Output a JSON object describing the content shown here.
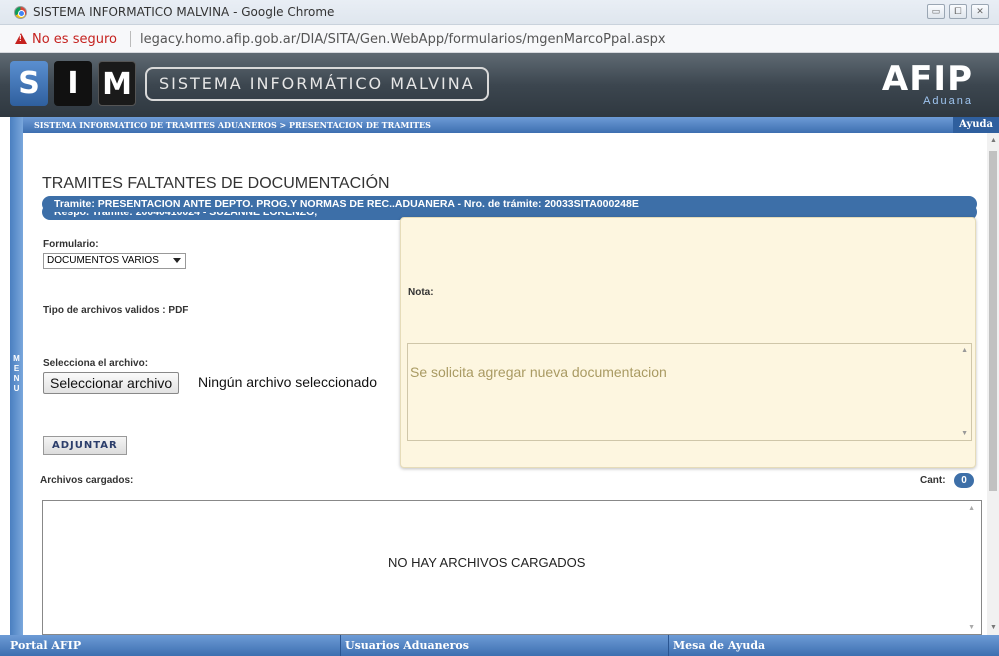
{
  "window": {
    "title": "SISTEMA INFORMATICO MALVINA - Google Chrome",
    "controls": [
      "▭",
      "⧠",
      "✕"
    ]
  },
  "address": {
    "security_label": "No es seguro",
    "url": "legacy.homo.afip.gob.ar/DIA/SITA/Gen.WebApp/formularios/mgenMarcoPpal.aspx"
  },
  "banner": {
    "s": "S",
    "i": "I",
    "m": "M",
    "system_name": "SISTEMA INFORMÁTICO MALVINA",
    "afip_logo": "AFIP",
    "aduana": "Aduana"
  },
  "side_menu": [
    "M",
    "E",
    "N",
    "U"
  ],
  "breadcrumb": "SISTEMA INFORMATICO DE TRAMITES ADUANEROS > PRESENTACION DE TRAMITES",
  "help_label": "Ayuda",
  "page_title": "TRAMITES FALTANTES DE DOCUMENTACIÓN",
  "resp_tramite": "Respo. Tramite: 20040410024 - SUZANNE LORENZO,",
  "tramite": "Tramite: PRESENTACION ANTE DEPTO. PROG.Y NORMAS DE REC..ADUANERA - Nro. de trámite: 20033SITA000248E",
  "form": {
    "formulario_label": "Formulario:",
    "formulario_value": "DOCUMENTOS VARIOS",
    "tipo_archivos": "Tipo de archivos validos : PDF",
    "selecciona_label": "Selecciona el archivo:",
    "file_button": "Seleccionar archivo",
    "no_file": "Ningún archivo seleccionado",
    "adjuntar": "ADJUNTAR"
  },
  "nota": {
    "label": "Nota:",
    "text": "Se solicita agregar nueva documentacion"
  },
  "archivos": {
    "label": "Archivos cargados:",
    "cant_label": "Cant:",
    "count": "0",
    "empty_message": "NO HAY ARCHIVOS CARGADOS"
  },
  "footer": {
    "portal": "Portal AFIP",
    "usuarios": "Usuarios Aduaneros",
    "mesa": "Mesa de Ayuda"
  }
}
